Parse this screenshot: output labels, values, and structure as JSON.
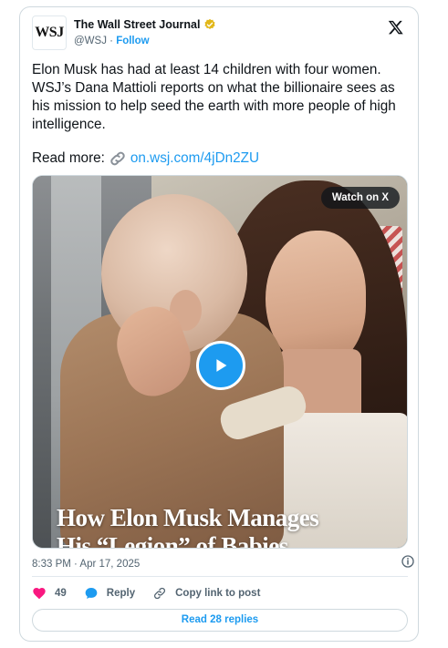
{
  "account": {
    "avatar_text": "WSJ",
    "name": "The Wall Street Journal",
    "handle": "@WSJ",
    "separator": " · ",
    "follow_label": "Follow"
  },
  "tweet": {
    "text": "Elon Musk has had at least 14 children with four women. WSJ’s Dana Mattioli reports on what the billionaire sees as his mission to help seed the earth with more people of high intelligence.",
    "read_more_prefix": "Read more:",
    "link_text": "on.wsj.com/4jDn2ZU"
  },
  "media": {
    "watch_label": "Watch on X",
    "title_line1": "How Elon Musk Manages",
    "title_line2": "His “Legion” of Babies"
  },
  "meta": {
    "timestamp": "8:33 PM · Apr 17, 2025"
  },
  "actions": {
    "like_count": "49",
    "reply_label": "Reply",
    "copy_label": "Copy link to post"
  },
  "footer": {
    "read_replies_label": "Read 28 replies"
  },
  "colors": {
    "accent": "#1d9bf0",
    "like": "#f91880",
    "verified": "#e2b719"
  }
}
